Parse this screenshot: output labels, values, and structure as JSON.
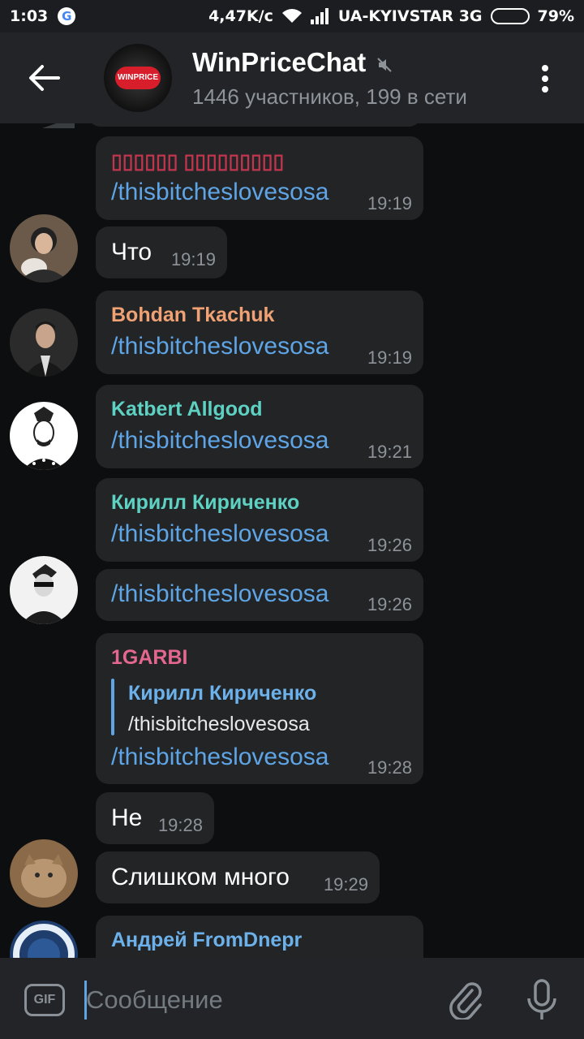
{
  "status_bar": {
    "time": "1:03",
    "google_letter": "G",
    "speed": "4,47K/c",
    "carrier": "UA-KYIVSTAR 3G",
    "battery": "79%",
    "battery_level": 0.79
  },
  "header": {
    "avatar_text": "WINPRICE",
    "title": "WinPriceChat",
    "subtitle": "1446 участников, 199 в сети"
  },
  "messages": [
    {
      "sender": "▯▯▯▯▯▯ ▯▯▯▯▯▯▯▯▯",
      "sender_color": "#c0364e",
      "text": "/thisbitcheslovesosa",
      "time": "19:19"
    },
    {
      "text": "Что",
      "time": "19:19"
    },
    {
      "sender": "Bohdan Tkachuk",
      "sender_color": "#f0a274",
      "text": "/thisbitcheslovesosa",
      "time": "19:19"
    },
    {
      "sender": "Katbert Allgood",
      "sender_color": "#5ed1c3",
      "text": "/thisbitcheslovesosa",
      "time": "19:21"
    },
    {
      "sender": "Кирилл Кириченко",
      "sender_color": "#5ed1c3",
      "text": "/thisbitcheslovesosa",
      "time": "19:26"
    },
    {
      "text": "/thisbitcheslovesosa",
      "time": "19:26"
    },
    {
      "sender": "1GARBI",
      "sender_color": "#e3678e",
      "reply_name": "Кирилл Кириченко",
      "reply_text": "/thisbitcheslovesosa",
      "text": "/thisbitcheslovesosa",
      "time": "19:28"
    },
    {
      "text": "Не",
      "time": "19:28"
    },
    {
      "text": "Слишком много",
      "time": "19:29"
    },
    {
      "sender": "Андрей FromDnepr",
      "sender_color": "#6db1ea"
    }
  ],
  "composer": {
    "gif_label": "GIF",
    "placeholder": "Сообщение"
  }
}
